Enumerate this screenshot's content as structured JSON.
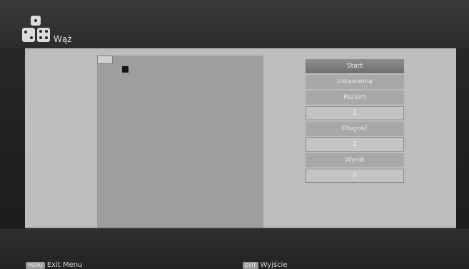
{
  "header": {
    "title": "Wąż"
  },
  "menu": {
    "items": [
      {
        "label": "Start",
        "kind": "selected"
      },
      {
        "label": "Ustawienia",
        "kind": "label"
      },
      {
        "label": "Poziom",
        "kind": "label"
      },
      {
        "label": "1",
        "kind": "value"
      },
      {
        "label": "Długość",
        "kind": "label"
      },
      {
        "label": "2",
        "kind": "value"
      },
      {
        "label": "Wynik",
        "kind": "label"
      },
      {
        "label": "0",
        "kind": "value"
      }
    ]
  },
  "footer": {
    "left": {
      "key": "MENU",
      "label": "Exit Menu"
    },
    "right": {
      "key": "EXIT",
      "label": "Wyjście"
    }
  },
  "colors": {
    "panel": "#bdbdbd",
    "board": "#9e9e9e",
    "snake": "#151515"
  }
}
